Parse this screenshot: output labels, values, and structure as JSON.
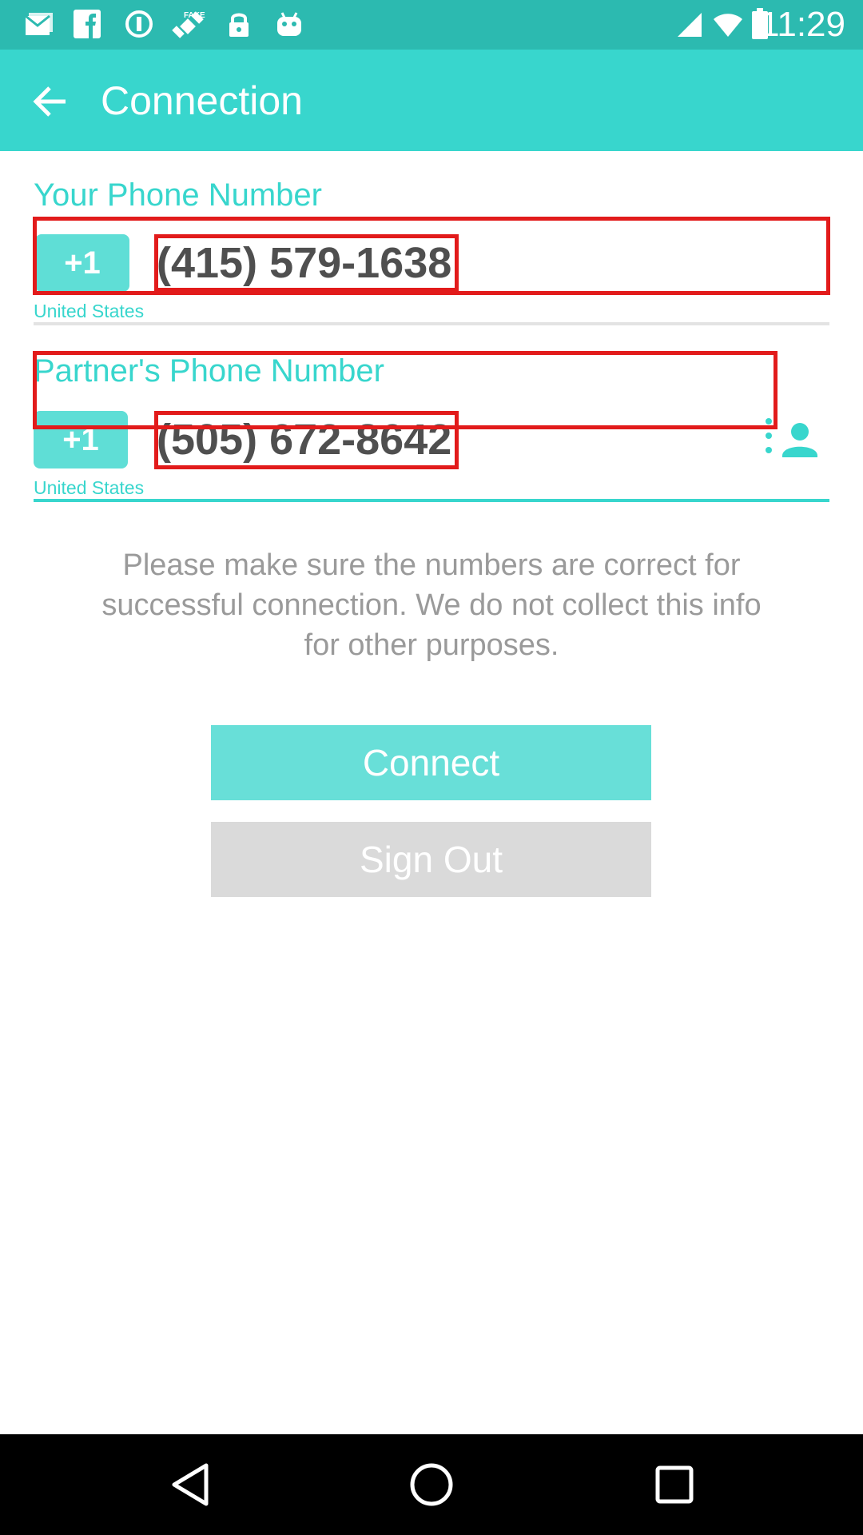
{
  "status_bar": {
    "time": "11:29",
    "icons": [
      "email-icon",
      "facebook-icon",
      "sync-icon",
      "fake-gps-icon",
      "lock-icon",
      "android-icon"
    ]
  },
  "app_bar": {
    "title": "Connection",
    "back_icon": "arrow-left-icon"
  },
  "your_phone": {
    "label": "Your Phone Number",
    "country_code": "+1",
    "number": "(415) 579-1638",
    "country": "United States"
  },
  "partner_phone": {
    "label": "Partner's Phone Number",
    "country_code": "+1",
    "number": "(505) 672-8642",
    "country": "United States",
    "contact_icon": "contact-picker-icon"
  },
  "info": {
    "text": "Please make sure the numbers are correct for successful connection. We do not collect this info for other purposes."
  },
  "buttons": {
    "connect": "Connect",
    "sign_out": "Sign Out"
  },
  "nav_bar": {
    "icons": [
      "back-triangle-icon",
      "home-circle-icon",
      "recents-square-icon"
    ]
  },
  "colors": {
    "accent": "#38d6cd",
    "status_bar": "#2cbab0",
    "highlight_box": "#e21b1b"
  }
}
